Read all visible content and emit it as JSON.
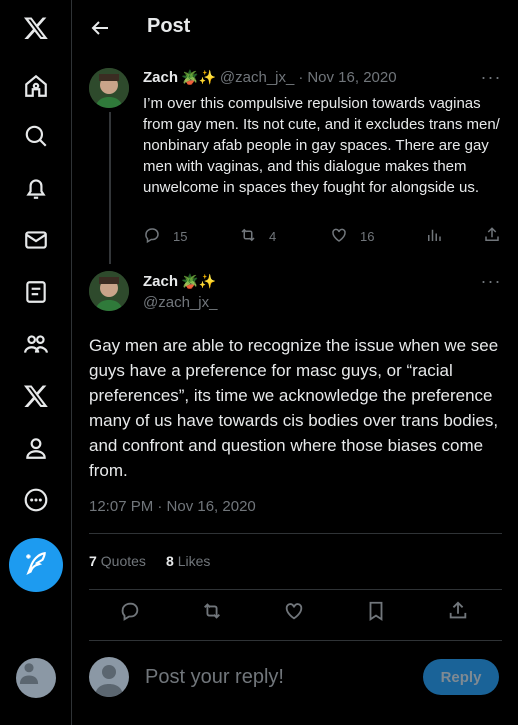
{
  "nav": {
    "items": [
      {
        "icon": "x-logo-icon"
      },
      {
        "icon": "home-icon"
      },
      {
        "icon": "search-icon"
      },
      {
        "icon": "notifications-icon"
      },
      {
        "icon": "messages-icon"
      },
      {
        "icon": "lists-icon"
      },
      {
        "icon": "communities-icon"
      },
      {
        "icon": "premium-x-icon"
      },
      {
        "icon": "profile-icon"
      },
      {
        "icon": "more-icon"
      }
    ],
    "compose_icon": "compose-feather-icon"
  },
  "header": {
    "title": "Post"
  },
  "parent_tweet": {
    "name": "Zach",
    "emoji": "🪴✨",
    "handle": "@zach_jx_",
    "date": "Nov 16, 2020",
    "text": "I’m over this compulsive repulsion towards vaginas from gay men. Its not cute, and it excludes trans men/ nonbinary afab people in gay spaces. There are gay men with vaginas, and this dialogue makes them unwelcome in spaces they fought for alongside us.",
    "replies": "15",
    "reposts": "4",
    "likes": "16"
  },
  "main_tweet": {
    "name": "Zach",
    "emoji": "🪴✨",
    "handle": "@zach_jx_",
    "text": "Gay men are able to recognize the issue when we see guys have a preference for masc guys, or “racial preferences”, its time we acknowledge the preference many of us have towards cis bodies over trans bodies, and confront and question where those biases come from.",
    "timestamp": "12:07 PM · Nov 16, 2020",
    "quotes_count": "7",
    "quotes_label": "Quotes",
    "likes_count": "8",
    "likes_label": "Likes"
  },
  "reply": {
    "placeholder": "Post your reply!",
    "button_label": "Reply"
  },
  "colors": {
    "accent": "#1d9bf0",
    "muted": "#71767b",
    "text": "#e7e9ea",
    "background": "#000000"
  }
}
